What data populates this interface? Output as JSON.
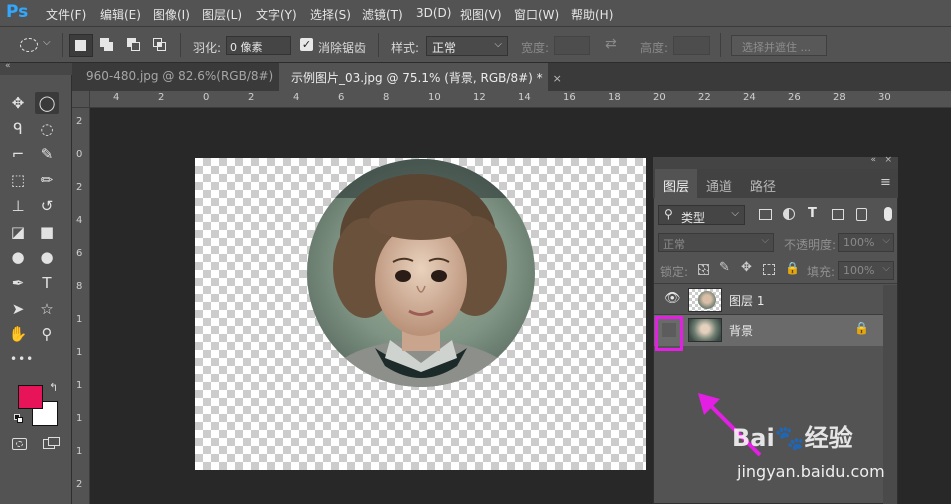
{
  "app": {
    "logo": "Ps"
  },
  "menu": [
    "文件(F)",
    "编辑(E)",
    "图像(I)",
    "图层(L)",
    "文字(Y)",
    "选择(S)",
    "滤镜(T)",
    "3D(D)",
    "视图(V)",
    "窗口(W)",
    "帮助(H)"
  ],
  "options": {
    "feather_label": "羽化:",
    "feather_value": "0 像素",
    "antialias_label": "消除锯齿",
    "style_label": "样式:",
    "style_value": "正常",
    "width_label": "宽度:",
    "height_label": "高度:",
    "select_mask_button": "选择并遮住 ..."
  },
  "tabs": [
    {
      "title": "960-480.jpg @ 82.6%(RGB/8#)",
      "close": "×",
      "active": false
    },
    {
      "title": "示例图片_03.jpg @ 75.1% (背景, RGB/8#) *",
      "close": "×",
      "active": true
    }
  ],
  "ruler": {
    "top_labels": [
      "4",
      "2",
      "0",
      "2",
      "4",
      "6",
      "8",
      "10",
      "12",
      "14",
      "16",
      "18",
      "20",
      "22",
      "24",
      "26",
      "28",
      "30"
    ],
    "left_labels": [
      "2",
      "0",
      "2",
      "4",
      "6",
      "8",
      "1",
      "1",
      "1",
      "1",
      "1",
      "2"
    ]
  },
  "tools": [
    "move-icon",
    "elliptical-marquee-icon",
    "lasso-icon",
    "quick-select-icon",
    "crop-icon",
    "eyedropper-icon",
    "frame-icon",
    "brush-icon",
    "stamp-icon",
    "history-brush-icon",
    "eraser-icon",
    "gradient-icon",
    "blur-icon",
    "dodge-icon",
    "pen-icon",
    "type-icon",
    "path-select-icon",
    "shape-icon",
    "hand-icon",
    "zoom-icon"
  ],
  "tool_glyphs": [
    "✥",
    "◯",
    "ᑫ",
    "◌",
    "⌐",
    "✎",
    "⬚",
    "✏",
    "⊥",
    "↺",
    "◪",
    "■",
    "●",
    "●",
    "✒",
    "T",
    "➤",
    "☆",
    "✋",
    "⚲"
  ],
  "extra_tools_label": "•••",
  "colors": {
    "foreground": "#e8145a",
    "background": "#ffffff",
    "highlight": "#e41fe4"
  },
  "layers_panel": {
    "tabs": [
      "图层",
      "通道",
      "路径"
    ],
    "filter_label": "类型",
    "blend_mode": "正常",
    "opacity_label": "不透明度:",
    "opacity_value": "100%",
    "lock_label": "锁定:",
    "fill_label": "填充:",
    "fill_value": "100%",
    "layers": [
      {
        "name": "图层 1",
        "visible": true,
        "locked": false
      },
      {
        "name": "背景",
        "visible": false,
        "locked": true
      }
    ]
  },
  "watermark": {
    "text": "Bai🐾经验",
    "url": "jingyan.baidu.com"
  }
}
